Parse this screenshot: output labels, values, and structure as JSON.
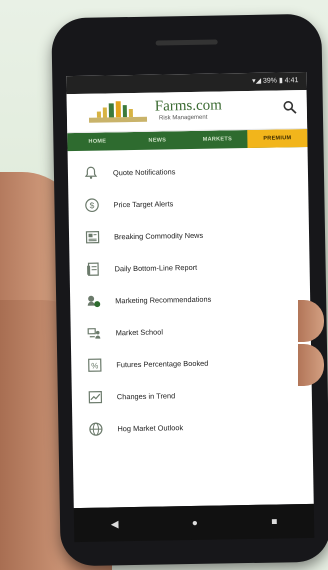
{
  "status_bar": {
    "text": "▾◢ 39% ▮ 4:41"
  },
  "header": {
    "logo_title": "Farms.com",
    "logo_subtitle": "Risk Management"
  },
  "tabs": [
    {
      "label": "HOME",
      "active": false
    },
    {
      "label": "NEWS",
      "active": false
    },
    {
      "label": "MARKETS",
      "active": false
    },
    {
      "label": "PREMIUM",
      "active": true
    }
  ],
  "menu": [
    {
      "label": "Quote Notifications",
      "icon": "bell-icon"
    },
    {
      "label": "Price Target Alerts",
      "icon": "dollar-icon"
    },
    {
      "label": "Breaking Commodity News",
      "icon": "newspaper-icon"
    },
    {
      "label": "Daily Bottom-Line Report",
      "icon": "report-icon"
    },
    {
      "label": "Marketing Recommendations",
      "icon": "recommendation-icon"
    },
    {
      "label": "Market School",
      "icon": "school-icon"
    },
    {
      "label": "Futures Percentage Booked",
      "icon": "percent-icon"
    },
    {
      "label": "Changes in Trend",
      "icon": "trend-icon"
    },
    {
      "label": "Hog Market Outlook",
      "icon": "globe-icon"
    }
  ],
  "colors": {
    "brand_green": "#2e6b2f",
    "accent_yellow": "#f2b51b"
  }
}
